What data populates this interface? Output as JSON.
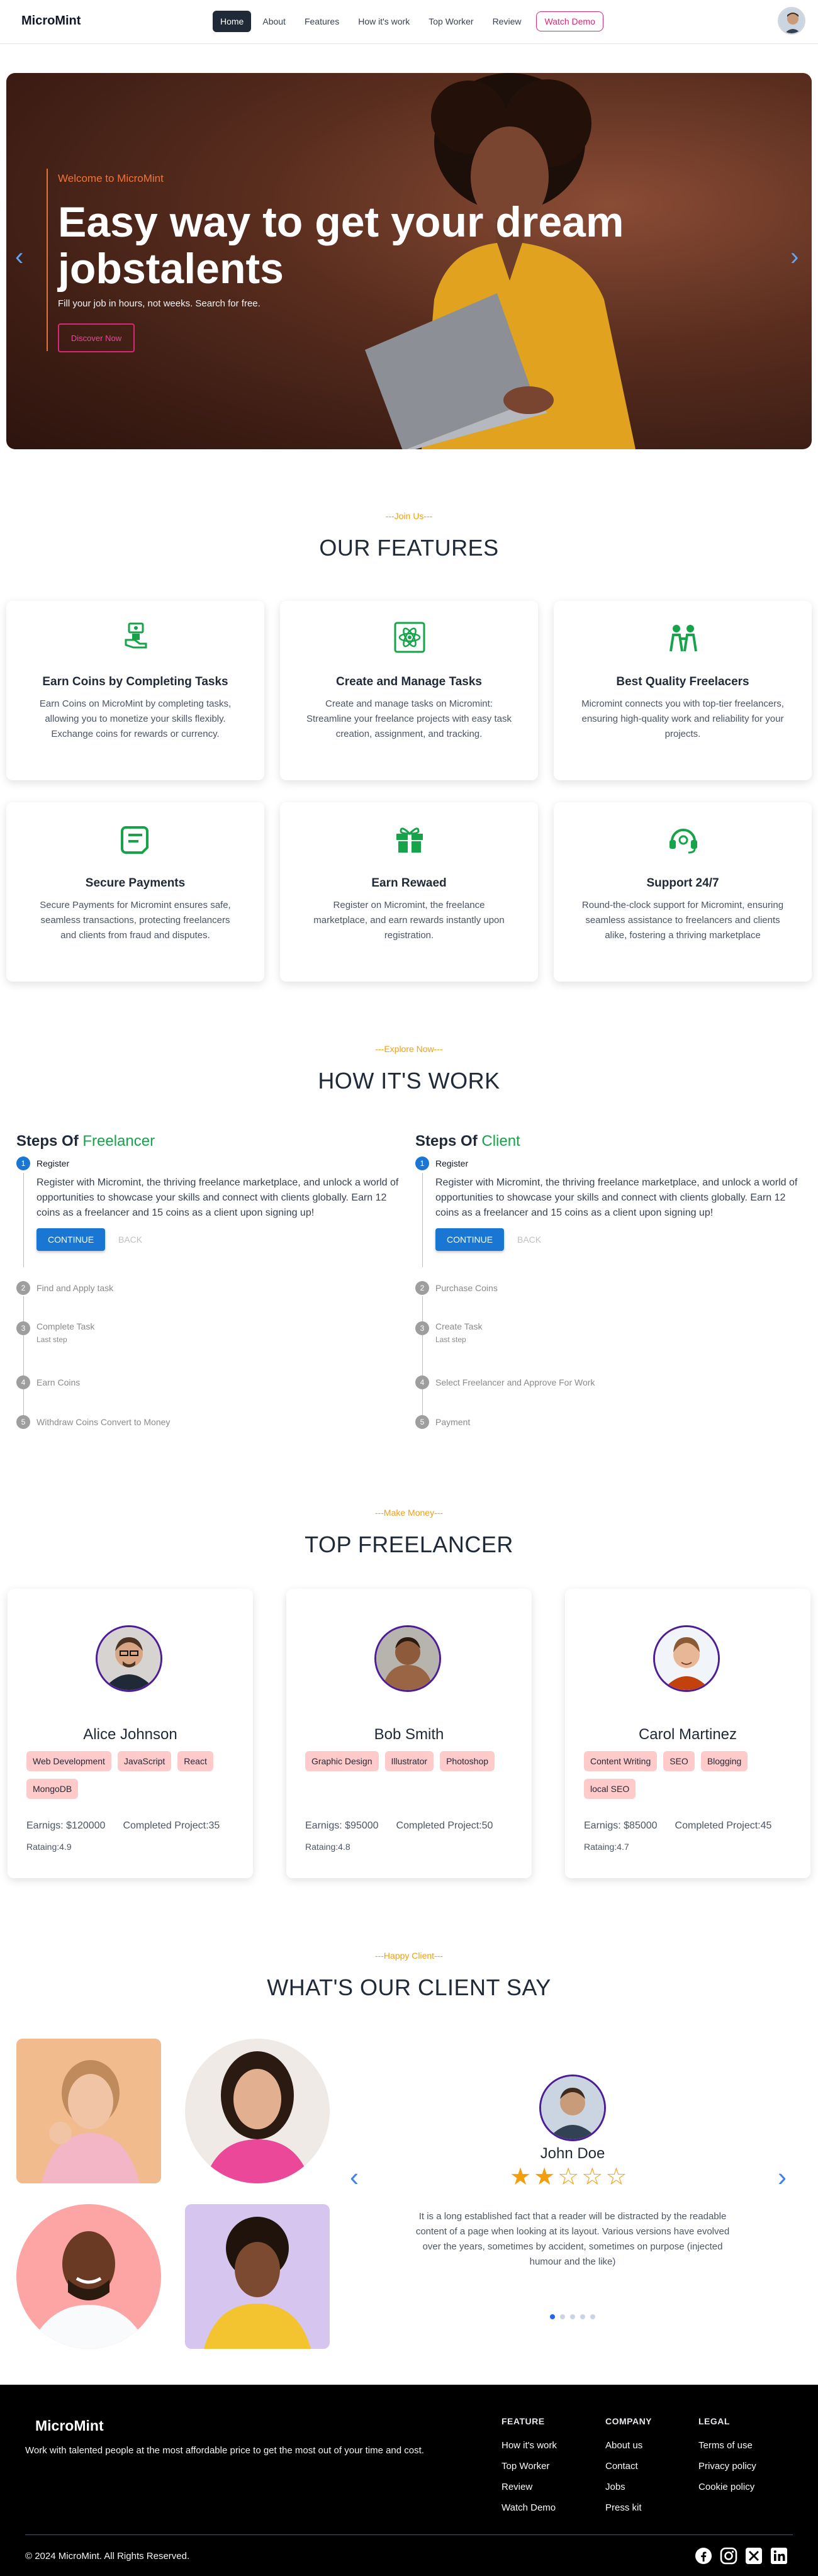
{
  "nav": {
    "brand": "MicroMint",
    "items": [
      "Home",
      "About",
      "Features",
      "How it's work",
      "Top Worker",
      "Review"
    ],
    "demo": "Watch Demo"
  },
  "hero": {
    "welcome": "Welcome to MicroMint",
    "title": "Easy way to get your dream jobstalents",
    "subtitle": "Fill your job in hours, not weeks. Search for free.",
    "button": "Discover Now"
  },
  "features": {
    "kicker": "---Join Us---",
    "title": "OUR FEATURES",
    "items": [
      {
        "icon": "money-hand-icon",
        "title": "Earn Coins by Completing Tasks",
        "desc": "Earn Coins on MicroMint by completing tasks, allowing you to monetize your skills flexibly. Exchange coins for rewards or currency."
      },
      {
        "icon": "atom-icon",
        "title": "Create and Manage Tasks",
        "desc": "Create and manage tasks on Micromint: Streamline your freelance projects with easy task creation, assignment, and tracking."
      },
      {
        "icon": "people-icon",
        "title": "Best Quality Freelacers",
        "desc": "Micromint connects you with top-tier freelancers, ensuring high-quality work and reliability for your projects."
      },
      {
        "icon": "payment-icon",
        "title": "Secure Payments",
        "desc": "Secure Payments for Micromint ensures safe, seamless transactions, protecting freelancers and clients from fraud and disputes."
      },
      {
        "icon": "gift-icon",
        "title": "Earn Rewaed",
        "desc": "Register on Micromint, the freelance marketplace, and earn rewards instantly upon registration."
      },
      {
        "icon": "headset-icon",
        "title": "Support 24/7",
        "desc": "Round-the-clock support for Micromint, ensuring seamless assistance to freelancers and clients alike, fostering a thriving marketplace"
      }
    ]
  },
  "how": {
    "kicker": "---Explore Now---",
    "title": "HOW IT'S WORK",
    "steps_of": "Steps Of",
    "freelancer": {
      "who": "Freelancer",
      "steps": [
        "Register",
        "Find and Apply task",
        "Complete Task",
        "Earn Coins",
        "Withdraw Coins Convert to Money"
      ],
      "body": "Register with Micromint, the thriving freelance marketplace, and unlock a world of opportunities to showcase your skills and connect with clients globally. Earn 12 coins as a freelancer and 15 coins as a client upon signing up!"
    },
    "client": {
      "who": "Client",
      "steps": [
        "Register",
        "Purchase Coins",
        "Create Task",
        "Select Freelancer and Approve For Work",
        "Payment"
      ],
      "body": "Register with Micromint, the thriving freelance marketplace, and unlock a world of opportunities to showcase your skills and connect with clients globally. Earn 12 coins as a freelancer and 15 coins as a client upon signing up!"
    },
    "optional": "Last step",
    "continue": "CONTINUE",
    "back": "BACK"
  },
  "top": {
    "kicker": "---Make Money---",
    "title": "TOP FREELANCER",
    "earn_prefix": "Earnigs:",
    "project_prefix": "Completed Project:",
    "rating_prefix": "Rataing:",
    "people": [
      {
        "name": "Alice Johnson",
        "tags": [
          "Web Development",
          "JavaScript",
          "React",
          "MongoDB"
        ],
        "earnings": "$120000",
        "projects": "35",
        "rating": "4.9"
      },
      {
        "name": "Bob Smith",
        "tags": [
          "Graphic Design",
          "Illustrator",
          "Photoshop"
        ],
        "earnings": "$95000",
        "projects": "50",
        "rating": "4.8"
      },
      {
        "name": "Carol Martinez",
        "tags": [
          "Content Writing",
          "SEO",
          "Blogging",
          "local SEO"
        ],
        "earnings": "$85000",
        "projects": "45",
        "rating": "4.7"
      }
    ]
  },
  "testimonials": {
    "kicker": "---Happy Client---",
    "title": "WHAT'S OUR CLIENT SAY",
    "name": "John Doe",
    "rating": 2,
    "stars_total": 5,
    "text": "It is a long established fact that a reader will be distracted by the readable content of a page when looking at its layout. Various versions have evolved over the years, sometimes by accident, sometimes on purpose (injected humour and the like)",
    "slides": 5,
    "active_slide": 1
  },
  "footer": {
    "brand": "MicroMint",
    "tagline": "Work with talented people at the most affordable price to get the most out of your time and cost.",
    "columns": [
      {
        "title": "FEATURE",
        "links": [
          "How it's work",
          "Top Worker",
          "Review",
          "Watch Demo"
        ]
      },
      {
        "title": "COMPANY",
        "links": [
          "About us",
          "Contact",
          "Jobs",
          "Press kit"
        ]
      },
      {
        "title": "LEGAL",
        "links": [
          "Terms of use",
          "Privacy policy",
          "Cookie policy"
        ]
      }
    ],
    "copyright": "© 2024 MicroMint. All Rights Reserved.",
    "social": [
      "facebook-icon",
      "instagram-icon",
      "x-icon",
      "linkedin-icon"
    ]
  },
  "colors": {
    "accent_orange": "#f2733a",
    "accent_pink": "#db2777",
    "accent_green": "#16a34a",
    "accent_blue": "#1976d2",
    "footer_bg": "#000000"
  }
}
